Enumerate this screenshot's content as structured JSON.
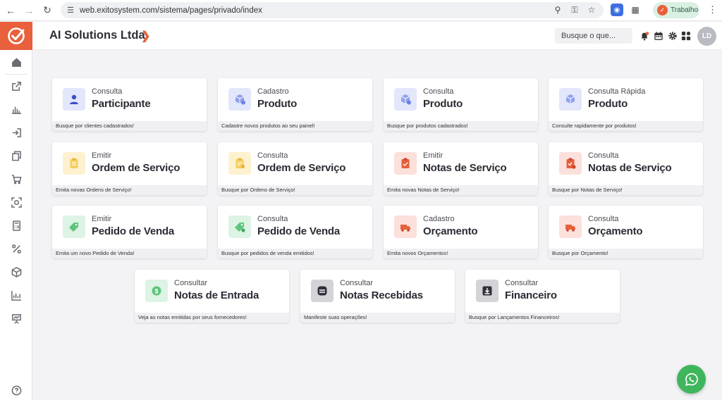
{
  "browser": {
    "url": "web.exitosystem.com/sistema/pages/privado/index",
    "profile_label": "Trabalho"
  },
  "header": {
    "company": "AI Solutions Ltda",
    "search_placeholder": "Busque o que...",
    "avatar_initials": "LD"
  },
  "colors": {
    "brand": "#e8603c",
    "blue_tile": "#e3e7fb",
    "yellow_tile": "#fdf1cf",
    "red_tile": "#fbe0dc",
    "green_tile": "#ddf3e4",
    "gray_tile": "#d4d4d8"
  },
  "cards": [
    {
      "sub": "Consulta",
      "title": "Participante",
      "foot": "Busque por clientes cadastrados!",
      "icon": "person-icon"
    },
    {
      "sub": "Cadastro",
      "title": "Produto",
      "foot": "Cadastre novos produtos ao seu painel!",
      "icon": "box-add-icon"
    },
    {
      "sub": "Consulta",
      "title": "Produto",
      "foot": "Busque por produtos cadastrados!",
      "icon": "box-search-icon"
    },
    {
      "sub": "Consulta Rápida",
      "title": "Produto",
      "foot": "Consulte rapidamente por produtos!",
      "icon": "box-quick-icon"
    },
    {
      "sub": "Emitir",
      "title": "Ordem de Serviço",
      "foot": "Emita novas Ordens de Serviço!",
      "icon": "clipboard-icon"
    },
    {
      "sub": "Consulta",
      "title": "Ordem de Serviço",
      "foot": "Busque por Ordens de Serviço!",
      "icon": "clipboard-search-icon"
    },
    {
      "sub": "Emitir",
      "title": "Notas de Serviço",
      "foot": "Emita novas Notas de Serviço!",
      "icon": "invoice-icon"
    },
    {
      "sub": "Consulta",
      "title": "Notas de Serviço",
      "foot": "Busque por Notas de Serviço!",
      "icon": "invoice-search-icon"
    },
    {
      "sub": "Emitir",
      "title": "Pedido de Venda",
      "foot": "Emita um novo Pedido de Venda!",
      "icon": "tag-icon"
    },
    {
      "sub": "Consulta",
      "title": "Pedido de Venda",
      "foot": "Busque por pedidos de venda emitidos!",
      "icon": "tag-search-icon"
    },
    {
      "sub": "Cadastro",
      "title": "Orçamento",
      "foot": "Emita novos Orçamentos!",
      "icon": "truck-icon"
    },
    {
      "sub": "Consulta",
      "title": "Orçamento",
      "foot": "Busque por Orçamento!",
      "icon": "truck-search-icon"
    },
    {
      "sub": "Consultar",
      "title": "Notas de Entrada",
      "foot": "Veja as notas emitidas por seus fornecedores!",
      "icon": "money-icon"
    },
    {
      "sub": "Consultar",
      "title": "Notas Recebidas",
      "foot": "Manifeste suas operações!",
      "icon": "inbox-icon"
    },
    {
      "sub": "Consultar",
      "title": "Financeiro",
      "foot": "Busque por Lançamentos Financeiros!",
      "icon": "download-box-icon"
    }
  ]
}
